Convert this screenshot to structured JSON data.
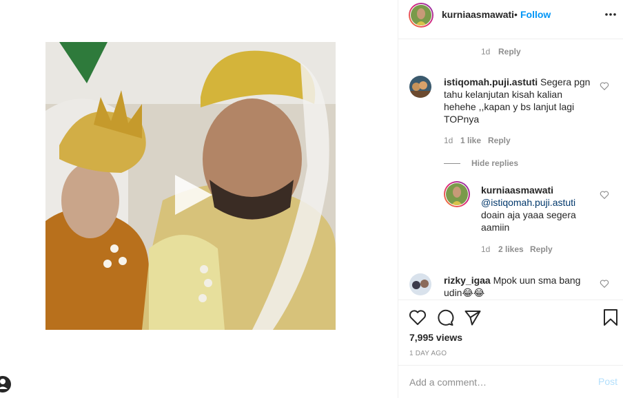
{
  "post": {
    "username": "kurniaasmawati",
    "separator": "•",
    "follow_label": "Follow",
    "more_icon": "more-horizontal-icon"
  },
  "comments": {
    "top_meta": {
      "time": "1d",
      "reply": "Reply"
    },
    "items": [
      {
        "username": "istiqomah.puji.astuti",
        "text": "Segera pgn tahu kelanjutan kisah kalian hehehe ,,kapan y bs lanjut lagi TOPnya",
        "time": "1d",
        "likes": "1 like",
        "reply": "Reply",
        "hide_replies": "Hide replies",
        "replies": [
          {
            "username": "kurniaasmawati",
            "mention": "@istiqomah.puji.astuti",
            "text": "doain aja yaaa segera aamiin",
            "time": "1d",
            "likes": "2 likes",
            "reply": "Reply"
          }
        ]
      },
      {
        "username": "rizky_igaa",
        "text": "Mpok uun sma bang udin😂😂"
      }
    ]
  },
  "actions": {
    "like_icon": "heart-icon",
    "comment_icon": "comment-icon",
    "share_icon": "share-icon",
    "save_icon": "bookmark-icon",
    "views": "7,995 views",
    "date": "1 DAY AGO"
  },
  "add_comment": {
    "placeholder": "Add a comment…",
    "post_label": "Post"
  },
  "colors": {
    "follow": "#0095f6",
    "post_disabled": "#b2dffc",
    "meta": "#8e8e8e",
    "mention": "#00376b"
  }
}
